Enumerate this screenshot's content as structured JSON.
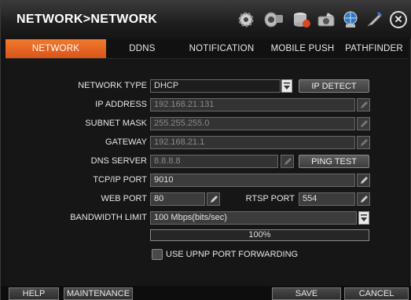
{
  "window": {
    "title": "NETWORK>NETWORK"
  },
  "toolbar_icons": [
    "gear-icon",
    "camera-icon",
    "storage-icon",
    "record-icon",
    "network-icon",
    "pen-icon"
  ],
  "tabs": [
    {
      "label": "NETWORK",
      "active": true
    },
    {
      "label": "DDNS",
      "active": false
    },
    {
      "label": "NOTIFICATION",
      "active": false
    },
    {
      "label": "MOBILE PUSH",
      "active": false
    },
    {
      "label": "PATHFINDER",
      "active": false
    }
  ],
  "form": {
    "network_type": {
      "label": "NETWORK TYPE",
      "value": "DHCP"
    },
    "ip_detect_label": "IP DETECT",
    "ip_address": {
      "label": "IP ADDRESS",
      "value": "192.168.21.131"
    },
    "subnet_mask": {
      "label": "SUBNET MASK",
      "value": "255.255.255.0"
    },
    "gateway": {
      "label": "GATEWAY",
      "value": "192.168.21.1"
    },
    "dns_server": {
      "label": "DNS SERVER",
      "value": "8.8.8.8"
    },
    "ping_test_label": "PING TEST",
    "tcp_ip_port": {
      "label": "TCP/IP PORT",
      "value": "9010"
    },
    "web_port": {
      "label": "WEB PORT",
      "value": "80"
    },
    "rtsp_port": {
      "label": "RTSP PORT",
      "value": "554"
    },
    "bandwidth_limit": {
      "label": "BANDWIDTH LIMIT",
      "value": "100 Mbps(bits/sec)"
    },
    "bandwidth_percent": "100%",
    "bandwidth_fraction": 1.0,
    "upnp": {
      "label": "USE UPNP PORT FORWARDING",
      "checked": false
    }
  },
  "bottom": {
    "help": "HELP",
    "maintenance": "MAINTENANCE",
    "save": "SAVE",
    "cancel": "CANCEL"
  },
  "colors": {
    "accent": "#e8652a",
    "background": "#161616"
  }
}
